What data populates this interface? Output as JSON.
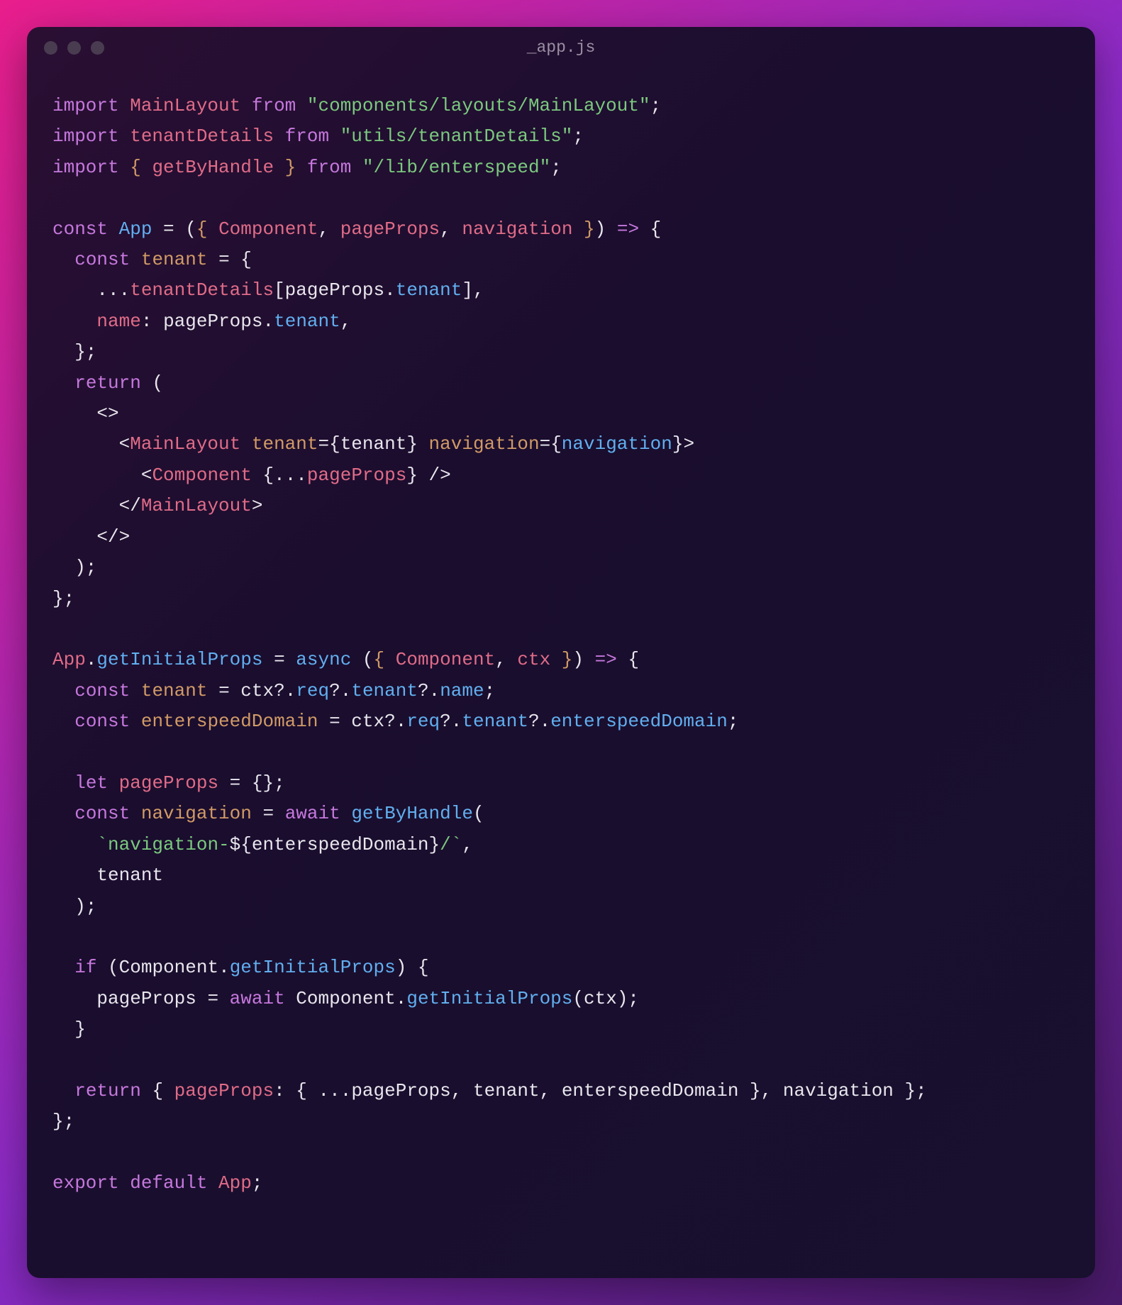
{
  "window": {
    "title": "_app.js"
  },
  "code": {
    "tokens": [
      [
        [
          "import ",
          "c-keyword"
        ],
        [
          "MainLayout",
          "c-ident"
        ],
        [
          " ",
          "c-punct"
        ],
        [
          "from",
          "c-from"
        ],
        [
          " ",
          "c-punct"
        ],
        [
          "\"components/layouts/MainLayout\"",
          "c-string"
        ],
        [
          ";",
          "c-punct"
        ]
      ],
      [
        [
          "import ",
          "c-keyword"
        ],
        [
          "tenantDetails",
          "c-ident"
        ],
        [
          " ",
          "c-punct"
        ],
        [
          "from",
          "c-from"
        ],
        [
          " ",
          "c-punct"
        ],
        [
          "\"utils/tenantDetails\"",
          "c-string"
        ],
        [
          ";",
          "c-punct"
        ]
      ],
      [
        [
          "import ",
          "c-keyword"
        ],
        [
          "{ ",
          "c-braces"
        ],
        [
          "getByHandle",
          "c-ident"
        ],
        [
          " }",
          "c-braces"
        ],
        [
          " ",
          "c-punct"
        ],
        [
          "from",
          "c-from"
        ],
        [
          " ",
          "c-punct"
        ],
        [
          "\"/lib/enterspeed\"",
          "c-string"
        ],
        [
          ";",
          "c-punct"
        ]
      ],
      [],
      [
        [
          "const ",
          "c-decl"
        ],
        [
          "App",
          "c-func"
        ],
        [
          " = ",
          "c-punct"
        ],
        [
          "(",
          "c-punct"
        ],
        [
          "{ ",
          "c-braces"
        ],
        [
          "Component",
          "c-ident"
        ],
        [
          ", ",
          "c-punct"
        ],
        [
          "pageProps",
          "c-ident"
        ],
        [
          ", ",
          "c-punct"
        ],
        [
          "navigation",
          "c-ident"
        ],
        [
          " }",
          "c-braces"
        ],
        [
          ")",
          "c-punct"
        ],
        [
          " ",
          "c-punct"
        ],
        [
          "=>",
          "c-decl"
        ],
        [
          " {",
          "c-punct"
        ]
      ],
      [
        [
          "  ",
          "c-punct"
        ],
        [
          "const ",
          "c-decl"
        ],
        [
          "tenant",
          "c-var"
        ],
        [
          " = {",
          "c-punct"
        ]
      ],
      [
        [
          "    ...",
          "c-punct"
        ],
        [
          "tenantDetails",
          "c-ident"
        ],
        [
          "[",
          "c-punct"
        ],
        [
          "pageProps",
          "c-punct"
        ],
        [
          ".",
          "c-punct"
        ],
        [
          "tenant",
          "c-prop"
        ],
        [
          "],",
          "c-punct"
        ]
      ],
      [
        [
          "    ",
          "c-punct"
        ],
        [
          "name",
          "c-ident"
        ],
        [
          ": ",
          "c-punct"
        ],
        [
          "pageProps",
          "c-punct"
        ],
        [
          ".",
          "c-punct"
        ],
        [
          "tenant",
          "c-prop"
        ],
        [
          ",",
          "c-punct"
        ]
      ],
      [
        [
          "  };",
          "c-punct"
        ]
      ],
      [
        [
          "  ",
          "c-punct"
        ],
        [
          "return",
          "c-decl"
        ],
        [
          " (",
          "c-punct"
        ]
      ],
      [
        [
          "    <>",
          "c-punct"
        ]
      ],
      [
        [
          "      <",
          "c-punct"
        ],
        [
          "MainLayout",
          "c-tag"
        ],
        [
          " ",
          "c-punct"
        ],
        [
          "tenant",
          "c-attr"
        ],
        [
          "=",
          "c-punct"
        ],
        [
          "{",
          "c-punct"
        ],
        [
          "tenant",
          "c-punct"
        ],
        [
          "}",
          "c-punct"
        ],
        [
          " ",
          "c-punct"
        ],
        [
          "navigation",
          "c-attr"
        ],
        [
          "=",
          "c-punct"
        ],
        [
          "{",
          "c-punct"
        ],
        [
          "navigation",
          "c-prop"
        ],
        [
          "}",
          "c-punct"
        ],
        [
          ">",
          "c-punct"
        ]
      ],
      [
        [
          "        <",
          "c-punct"
        ],
        [
          "Component",
          "c-tag"
        ],
        [
          " ",
          "c-punct"
        ],
        [
          "{",
          "c-punct"
        ],
        [
          "...",
          "c-punct"
        ],
        [
          "pageProps",
          "c-ident"
        ],
        [
          "}",
          "c-punct"
        ],
        [
          " />",
          "c-punct"
        ]
      ],
      [
        [
          "      </",
          "c-punct"
        ],
        [
          "MainLayout",
          "c-tag"
        ],
        [
          ">",
          "c-punct"
        ]
      ],
      [
        [
          "    </>",
          "c-punct"
        ]
      ],
      [
        [
          "  );",
          "c-punct"
        ]
      ],
      [
        [
          "};",
          "c-punct"
        ]
      ],
      [],
      [
        [
          "App",
          "c-ident"
        ],
        [
          ".",
          "c-punct"
        ],
        [
          "getInitialProps",
          "c-prop"
        ],
        [
          " = ",
          "c-punct"
        ],
        [
          "async",
          "c-async"
        ],
        [
          " (",
          "c-punct"
        ],
        [
          "{ ",
          "c-braces"
        ],
        [
          "Component",
          "c-ident"
        ],
        [
          ", ",
          "c-punct"
        ],
        [
          "ctx",
          "c-ident"
        ],
        [
          " }",
          "c-braces"
        ],
        [
          ") ",
          "c-punct"
        ],
        [
          "=>",
          "c-decl"
        ],
        [
          " {",
          "c-punct"
        ]
      ],
      [
        [
          "  ",
          "c-punct"
        ],
        [
          "const ",
          "c-decl"
        ],
        [
          "tenant",
          "c-var"
        ],
        [
          " = ",
          "c-punct"
        ],
        [
          "ctx",
          "c-punct"
        ],
        [
          "?.",
          "c-punct"
        ],
        [
          "req",
          "c-prop"
        ],
        [
          "?.",
          "c-punct"
        ],
        [
          "tenant",
          "c-prop"
        ],
        [
          "?.",
          "c-punct"
        ],
        [
          "name",
          "c-prop"
        ],
        [
          ";",
          "c-punct"
        ]
      ],
      [
        [
          "  ",
          "c-punct"
        ],
        [
          "const ",
          "c-decl"
        ],
        [
          "enterspeedDomain",
          "c-var"
        ],
        [
          " = ",
          "c-punct"
        ],
        [
          "ctx",
          "c-punct"
        ],
        [
          "?.",
          "c-punct"
        ],
        [
          "req",
          "c-prop"
        ],
        [
          "?.",
          "c-punct"
        ],
        [
          "tenant",
          "c-prop"
        ],
        [
          "?.",
          "c-punct"
        ],
        [
          "enterspeedDomain",
          "c-prop"
        ],
        [
          ";",
          "c-punct"
        ]
      ],
      [],
      [
        [
          "  ",
          "c-punct"
        ],
        [
          "let ",
          "c-decl"
        ],
        [
          "pageProps",
          "c-ident"
        ],
        [
          " = {};",
          "c-punct"
        ]
      ],
      [
        [
          "  ",
          "c-punct"
        ],
        [
          "const ",
          "c-decl"
        ],
        [
          "navigation",
          "c-var"
        ],
        [
          " = ",
          "c-punct"
        ],
        [
          "await",
          "c-await"
        ],
        [
          " ",
          "c-punct"
        ],
        [
          "getByHandle",
          "c-func"
        ],
        [
          "(",
          "c-punct"
        ]
      ],
      [
        [
          "    ",
          "c-punct"
        ],
        [
          "`navigation-",
          "c-string"
        ],
        [
          "${",
          "c-punct"
        ],
        [
          "enterspeedDomain",
          "c-punct"
        ],
        [
          "}",
          "c-punct"
        ],
        [
          "/`",
          "c-string"
        ],
        [
          ",",
          "c-punct"
        ]
      ],
      [
        [
          "    ",
          "c-punct"
        ],
        [
          "tenant",
          "c-punct"
        ]
      ],
      [
        [
          "  );",
          "c-punct"
        ]
      ],
      [],
      [
        [
          "  ",
          "c-punct"
        ],
        [
          "if",
          "c-decl"
        ],
        [
          " (",
          "c-punct"
        ],
        [
          "Component",
          "c-punct"
        ],
        [
          ".",
          "c-punct"
        ],
        [
          "getInitialProps",
          "c-prop"
        ],
        [
          ") {",
          "c-punct"
        ]
      ],
      [
        [
          "    ",
          "c-punct"
        ],
        [
          "pageProps",
          "c-punct"
        ],
        [
          " = ",
          "c-punct"
        ],
        [
          "await",
          "c-await"
        ],
        [
          " ",
          "c-punct"
        ],
        [
          "Component",
          "c-punct"
        ],
        [
          ".",
          "c-punct"
        ],
        [
          "getInitialProps",
          "c-func"
        ],
        [
          "(",
          "c-punct"
        ],
        [
          "ctx",
          "c-punct"
        ],
        [
          ");",
          "c-punct"
        ]
      ],
      [
        [
          "  }",
          "c-punct"
        ]
      ],
      [],
      [
        [
          "  ",
          "c-punct"
        ],
        [
          "return",
          "c-decl"
        ],
        [
          " { ",
          "c-punct"
        ],
        [
          "pageProps",
          "c-ident"
        ],
        [
          ": { ...",
          "c-punct"
        ],
        [
          "pageProps",
          "c-punct"
        ],
        [
          ", ",
          "c-punct"
        ],
        [
          "tenant",
          "c-punct"
        ],
        [
          ", ",
          "c-punct"
        ],
        [
          "enterspeedDomain",
          "c-punct"
        ],
        [
          " }, ",
          "c-punct"
        ],
        [
          "navigation",
          "c-punct"
        ],
        [
          " };",
          "c-punct"
        ]
      ],
      [
        [
          "};",
          "c-punct"
        ]
      ],
      [],
      [
        [
          "export ",
          "c-keyword"
        ],
        [
          "default",
          "c-decl"
        ],
        [
          " ",
          "c-punct"
        ],
        [
          "App",
          "c-ident"
        ],
        [
          ";",
          "c-punct"
        ]
      ]
    ]
  }
}
